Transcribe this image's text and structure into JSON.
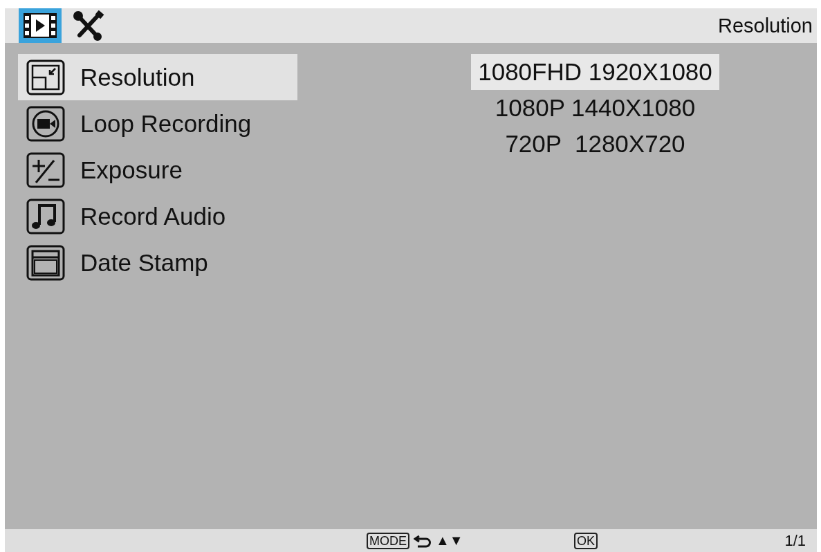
{
  "tabs": [
    {
      "kind": "video",
      "selected": true
    },
    {
      "kind": "tools",
      "selected": false
    }
  ],
  "header_title": "Resolution",
  "menu": [
    {
      "kind": "resolution",
      "label": "Resolution",
      "selected": true
    },
    {
      "kind": "loop",
      "label": "Loop Recording",
      "selected": false
    },
    {
      "kind": "exposure",
      "label": "Exposure",
      "selected": false
    },
    {
      "kind": "audio",
      "label": "Record Audio",
      "selected": false
    },
    {
      "kind": "date",
      "label": "Date Stamp",
      "selected": false
    }
  ],
  "options": [
    {
      "label": "1080FHD 1920X1080",
      "selected": true
    },
    {
      "label": "1080P 1440X1080",
      "selected": false
    },
    {
      "label": "720P  1280X720",
      "selected": false
    }
  ],
  "footer": {
    "mode_key": "MODE",
    "arrows": "▲▼",
    "ok_key": "OK",
    "page": "1/1"
  }
}
